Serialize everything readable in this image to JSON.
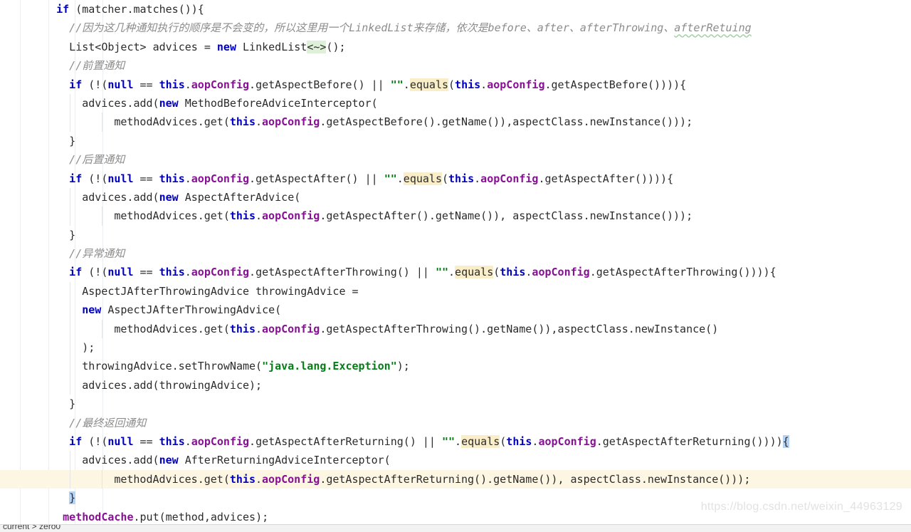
{
  "app": {
    "kind": "java-code-editor",
    "language": "Java",
    "theme": "IntelliJ Light"
  },
  "colors": {
    "background": "#ffffff",
    "text": "#2b2b2b",
    "keyword": "#0000c0",
    "field": "#871094",
    "string": "#067d17",
    "comment": "#8c8c8c",
    "current_line": "#fdf6e3",
    "search_highlight": "#faeec8",
    "brace_highlight": "#b5d3f5",
    "inlay_highlight": "#dff0d8",
    "indent_guide": "#e3e6e8",
    "gutter_rule": "#eceff1",
    "watermark": "#e2e2e2"
  },
  "gutter": {
    "rules_x": [
      28,
      68,
      105,
      144
    ]
  },
  "editor": {
    "font_size_px": 15,
    "line_height_px": 26.4,
    "current_line_index": 25,
    "lines": [
      {
        "indent": 7,
        "tokens": [
          {
            "t": "if",
            "c": "kw"
          },
          {
            "t": " (matcher.matches()){",
            "c": "pln"
          }
        ]
      },
      {
        "indent": 9,
        "tokens": [
          {
            "t": "//因为这几种通知执行的顺序是不会变的，所以这里用一个LinkedList来存储，依次是before、after、afterThrowing、",
            "c": "cmt"
          },
          {
            "t": "afterRetuing",
            "c": "cmt",
            "typo": true
          }
        ]
      },
      {
        "indent": 9,
        "tokens": [
          {
            "t": "List<Object> advices = ",
            "c": "pln"
          },
          {
            "t": "new",
            "c": "kw"
          },
          {
            "t": " LinkedList",
            "c": "pln"
          },
          {
            "t": "<~>",
            "c": "pln",
            "hl": "green"
          },
          {
            "t": "();",
            "c": "pln"
          }
        ]
      },
      {
        "indent": 9,
        "tokens": [
          {
            "t": "//前置通知",
            "c": "cmt"
          }
        ]
      },
      {
        "indent": 9,
        "tokens": [
          {
            "t": "if",
            "c": "kw"
          },
          {
            "t": " (!(",
            "c": "pln"
          },
          {
            "t": "null",
            "c": "kw"
          },
          {
            "t": " == ",
            "c": "pln"
          },
          {
            "t": "this",
            "c": "kw"
          },
          {
            "t": ".",
            "c": "pln"
          },
          {
            "t": "aopConfig",
            "c": "fld"
          },
          {
            "t": ".getAspectBefore() || ",
            "c": "pln"
          },
          {
            "t": "\"\"",
            "c": "str"
          },
          {
            "t": ".",
            "c": "pln"
          },
          {
            "t": "equals",
            "c": "pln",
            "hl": "search"
          },
          {
            "t": "(",
            "c": "pln"
          },
          {
            "t": "this",
            "c": "kw"
          },
          {
            "t": ".",
            "c": "pln"
          },
          {
            "t": "aopConfig",
            "c": "fld"
          },
          {
            "t": ".getAspectBefore()))){",
            "c": "pln"
          }
        ]
      },
      {
        "indent": 11,
        "tokens": [
          {
            "t": "advices.add(",
            "c": "pln"
          },
          {
            "t": "new",
            "c": "kw"
          },
          {
            "t": " MethodBeforeAdviceInterceptor(",
            "c": "pln"
          }
        ]
      },
      {
        "indent": 16,
        "tokens": [
          {
            "t": "methodAdvices.get(",
            "c": "pln"
          },
          {
            "t": "this",
            "c": "kw"
          },
          {
            "t": ".",
            "c": "pln"
          },
          {
            "t": "aopConfig",
            "c": "fld"
          },
          {
            "t": ".getAspectBefore().getName()),aspectClass.newInstance()));",
            "c": "pln"
          }
        ]
      },
      {
        "indent": 9,
        "tokens": [
          {
            "t": "}",
            "c": "pln"
          }
        ]
      },
      {
        "indent": 9,
        "tokens": [
          {
            "t": "//后置通知",
            "c": "cmt"
          }
        ]
      },
      {
        "indent": 9,
        "tokens": [
          {
            "t": "if",
            "c": "kw"
          },
          {
            "t": " (!(",
            "c": "pln"
          },
          {
            "t": "null",
            "c": "kw"
          },
          {
            "t": " == ",
            "c": "pln"
          },
          {
            "t": "this",
            "c": "kw"
          },
          {
            "t": ".",
            "c": "pln"
          },
          {
            "t": "aopConfig",
            "c": "fld"
          },
          {
            "t": ".getAspectAfter() || ",
            "c": "pln"
          },
          {
            "t": "\"\"",
            "c": "str"
          },
          {
            "t": ".",
            "c": "pln"
          },
          {
            "t": "equals",
            "c": "pln",
            "hl": "search"
          },
          {
            "t": "(",
            "c": "pln"
          },
          {
            "t": "this",
            "c": "kw"
          },
          {
            "t": ".",
            "c": "pln"
          },
          {
            "t": "aopConfig",
            "c": "fld"
          },
          {
            "t": ".getAspectAfter()))){",
            "c": "pln"
          }
        ]
      },
      {
        "indent": 11,
        "tokens": [
          {
            "t": "advices.add(",
            "c": "pln"
          },
          {
            "t": "new",
            "c": "kw"
          },
          {
            "t": " AspectAfterAdvice(",
            "c": "pln"
          }
        ]
      },
      {
        "indent": 16,
        "tokens": [
          {
            "t": "methodAdvices.get(",
            "c": "pln"
          },
          {
            "t": "this",
            "c": "kw"
          },
          {
            "t": ".",
            "c": "pln"
          },
          {
            "t": "aopConfig",
            "c": "fld"
          },
          {
            "t": ".getAspectAfter().getName()), aspectClass.newInstance()));",
            "c": "pln"
          }
        ]
      },
      {
        "indent": 9,
        "tokens": [
          {
            "t": "}",
            "c": "pln"
          }
        ]
      },
      {
        "indent": 9,
        "tokens": [
          {
            "t": "//异常通知",
            "c": "cmt"
          }
        ]
      },
      {
        "indent": 9,
        "tokens": [
          {
            "t": "if",
            "c": "kw"
          },
          {
            "t": " (!(",
            "c": "pln"
          },
          {
            "t": "null",
            "c": "kw"
          },
          {
            "t": " == ",
            "c": "pln"
          },
          {
            "t": "this",
            "c": "kw"
          },
          {
            "t": ".",
            "c": "pln"
          },
          {
            "t": "aopConfig",
            "c": "fld"
          },
          {
            "t": ".getAspectAfterThrowing() || ",
            "c": "pln"
          },
          {
            "t": "\"\"",
            "c": "str"
          },
          {
            "t": ".",
            "c": "pln"
          },
          {
            "t": "equals",
            "c": "pln",
            "hl": "search"
          },
          {
            "t": "(",
            "c": "pln"
          },
          {
            "t": "this",
            "c": "kw"
          },
          {
            "t": ".",
            "c": "pln"
          },
          {
            "t": "aopConfig",
            "c": "fld"
          },
          {
            "t": ".getAspectAfterThrowing()))){",
            "c": "pln"
          }
        ]
      },
      {
        "indent": 11,
        "tokens": [
          {
            "t": "AspectJAfterThrowingAdvice throwingAdvice =",
            "c": "pln"
          }
        ]
      },
      {
        "indent": 11,
        "tokens": [
          {
            "t": "new",
            "c": "kw"
          },
          {
            "t": " AspectJAfterThrowingAdvice(",
            "c": "pln"
          }
        ]
      },
      {
        "indent": 16,
        "tokens": [
          {
            "t": "methodAdvices.get(",
            "c": "pln"
          },
          {
            "t": "this",
            "c": "kw"
          },
          {
            "t": ".",
            "c": "pln"
          },
          {
            "t": "aopConfig",
            "c": "fld"
          },
          {
            "t": ".getAspectAfterThrowing().getName()),aspectClass.newInstance()",
            "c": "pln"
          }
        ]
      },
      {
        "indent": 11,
        "tokens": [
          {
            "t": ");",
            "c": "pln"
          }
        ]
      },
      {
        "indent": 11,
        "tokens": [
          {
            "t": "throwingAdvice.setThrowName(",
            "c": "pln"
          },
          {
            "t": "\"java.lang.Exception\"",
            "c": "str"
          },
          {
            "t": ");",
            "c": "pln"
          }
        ]
      },
      {
        "indent": 11,
        "tokens": [
          {
            "t": "advices.add(throwingAdvice);",
            "c": "pln"
          }
        ]
      },
      {
        "indent": 9,
        "tokens": [
          {
            "t": "}",
            "c": "pln"
          }
        ]
      },
      {
        "indent": 9,
        "tokens": [
          {
            "t": "//最终返回通知",
            "c": "cmt"
          }
        ]
      },
      {
        "indent": 9,
        "tokens": [
          {
            "t": "if",
            "c": "kw"
          },
          {
            "t": " (!(",
            "c": "pln"
          },
          {
            "t": "null",
            "c": "kw"
          },
          {
            "t": " == ",
            "c": "pln"
          },
          {
            "t": "this",
            "c": "kw"
          },
          {
            "t": ".",
            "c": "pln"
          },
          {
            "t": "aopConfig",
            "c": "fld"
          },
          {
            "t": ".getAspectAfterReturning() || ",
            "c": "pln"
          },
          {
            "t": "\"\"",
            "c": "str"
          },
          {
            "t": ".",
            "c": "pln"
          },
          {
            "t": "equals",
            "c": "pln",
            "hl": "search"
          },
          {
            "t": "(",
            "c": "pln"
          },
          {
            "t": "this",
            "c": "kw"
          },
          {
            "t": ".",
            "c": "pln"
          },
          {
            "t": "aopConfig",
            "c": "fld"
          },
          {
            "t": ".getAspectAfterReturning())))",
            "c": "pln"
          },
          {
            "t": "{",
            "c": "pln",
            "hl": "brace"
          }
        ]
      },
      {
        "indent": 11,
        "tokens": [
          {
            "t": "advices.add(",
            "c": "pln"
          },
          {
            "t": "new",
            "c": "kw"
          },
          {
            "t": " AfterReturningAdviceInterceptor(",
            "c": "pln"
          }
        ]
      },
      {
        "indent": 16,
        "tokens": [
          {
            "t": "methodAdvices.get(",
            "c": "pln"
          },
          {
            "t": "this",
            "c": "kw"
          },
          {
            "t": ".",
            "c": "pln"
          },
          {
            "t": "aopConfig",
            "c": "fld"
          },
          {
            "t": ".getAspectAfterReturning().getName()), aspectClass.newInstance()));",
            "c": "pln"
          }
        ]
      },
      {
        "indent": 9,
        "tokens": [
          {
            "t": "}",
            "c": "pln",
            "hl": "brace"
          }
        ]
      },
      {
        "indent": 8,
        "tokens": [
          {
            "t": "methodCache",
            "c": "fld"
          },
          {
            "t": ".put(method,advices);",
            "c": "pln"
          }
        ]
      }
    ]
  },
  "breadcrumb": {
    "text": "current  >  zero0"
  },
  "watermark": {
    "text": "https://blog.csdn.net/weixin_44963129"
  }
}
